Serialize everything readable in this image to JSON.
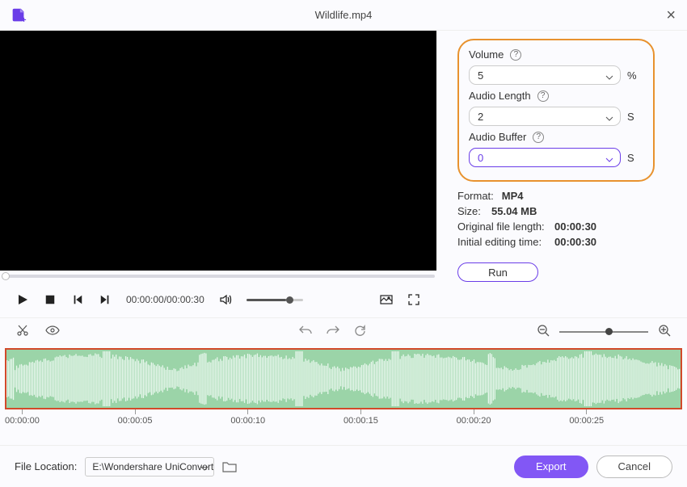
{
  "title": "Wildlife.mp4",
  "side": {
    "volume_label": "Volume",
    "volume_value": "5",
    "volume_unit": "%",
    "audio_length_label": "Audio Length",
    "audio_length_value": "2",
    "audio_length_unit": "S",
    "audio_buffer_label": "Audio Buffer",
    "audio_buffer_value": "0",
    "audio_buffer_unit": "S",
    "format_label": "Format:",
    "format_value": "MP4",
    "size_label": "Size:",
    "size_value": "55.04 MB",
    "orig_len_label": "Original file length:",
    "orig_len_value": "00:00:30",
    "init_time_label": "Initial editing time:",
    "init_time_value": "00:00:30",
    "run_label": "Run"
  },
  "controls": {
    "time_display": "00:00:00/00:00:30"
  },
  "ruler": [
    "00:00:00",
    "00:00:05",
    "00:00:10",
    "00:00:15",
    "00:00:20",
    "00:00:25"
  ],
  "footer": {
    "location_label": "File Location:",
    "path_value": "E:\\Wondershare UniConverter",
    "export_label": "Export",
    "cancel_label": "Cancel"
  }
}
